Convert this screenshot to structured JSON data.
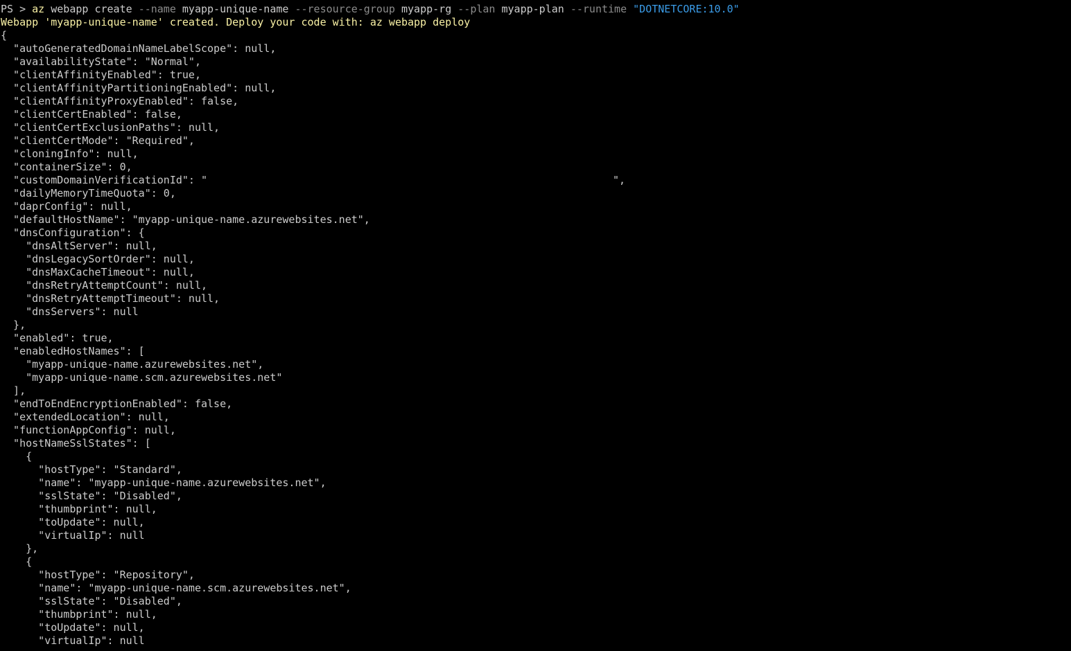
{
  "terminal": {
    "prompt": "PS > ",
    "command": {
      "program": "az",
      "group": "webapp",
      "action": "create",
      "flag_name": "--name",
      "name_value": "myapp-unique-name",
      "flag_resource_group": "--resource-group",
      "resource_group_value": "myapp-rg",
      "flag_plan": "--plan",
      "plan_value": "myapp-plan",
      "flag_runtime": "--runtime",
      "runtime_value": "\"DOTNETCORE:10.0\""
    },
    "message": "Webapp 'myapp-unique-name' created. Deploy your code with: az webapp deploy",
    "output_lines": [
      "{",
      "  \"autoGeneratedDomainNameLabelScope\": null,",
      "  \"availabilityState\": \"Normal\",",
      "  \"clientAffinityEnabled\": true,",
      "  \"clientAffinityPartitioningEnabled\": null,",
      "  \"clientAffinityProxyEnabled\": false,",
      "  \"clientCertEnabled\": false,",
      "  \"clientCertExclusionPaths\": null,",
      "  \"clientCertMode\": \"Required\",",
      "  \"cloningInfo\": null,",
      "  \"containerSize\": 0,"
    ],
    "redacted_line": {
      "prefix": "  \"customDomainVerificationId\": \"",
      "suffix": "\","
    },
    "output_lines_2": [
      "  \"dailyMemoryTimeQuota\": 0,",
      "  \"daprConfig\": null,",
      "  \"defaultHostName\": \"myapp-unique-name.azurewebsites.net\",",
      "  \"dnsConfiguration\": {",
      "    \"dnsAltServer\": null,",
      "    \"dnsLegacySortOrder\": null,",
      "    \"dnsMaxCacheTimeout\": null,",
      "    \"dnsRetryAttemptCount\": null,",
      "    \"dnsRetryAttemptTimeout\": null,",
      "    \"dnsServers\": null",
      "  },",
      "  \"enabled\": true,",
      "  \"enabledHostNames\": [",
      "    \"myapp-unique-name.azurewebsites.net\",",
      "    \"myapp-unique-name.scm.azurewebsites.net\"",
      "  ],",
      "  \"endToEndEncryptionEnabled\": false,",
      "  \"extendedLocation\": null,",
      "  \"functionAppConfig\": null,",
      "  \"hostNameSslStates\": [",
      "    {",
      "      \"hostType\": \"Standard\",",
      "      \"name\": \"myapp-unique-name.azurewebsites.net\",",
      "      \"sslState\": \"Disabled\",",
      "      \"thumbprint\": null,",
      "      \"toUpdate\": null,",
      "      \"virtualIp\": null",
      "    },",
      "    {",
      "      \"hostType\": \"Repository\",",
      "      \"name\": \"myapp-unique-name.scm.azurewebsites.net\",",
      "      \"sslState\": \"Disabled\",",
      "      \"thumbprint\": null,",
      "      \"toUpdate\": null,",
      "      \"virtualIp\": null"
    ],
    "colors": {
      "background": "#000000",
      "text": "#cccccc",
      "command": "#f9f1a5",
      "flag": "#8c8c8c",
      "string_arg": "#3b9ce8"
    }
  }
}
